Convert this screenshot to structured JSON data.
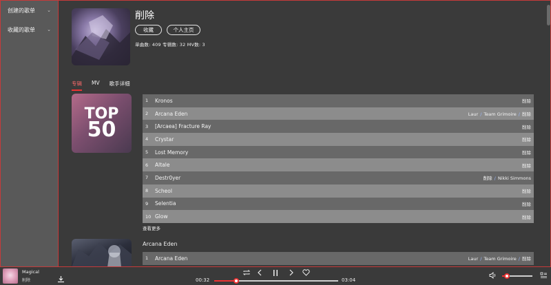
{
  "sidebar": {
    "items": [
      {
        "label": "创建的歌单"
      },
      {
        "label": "收藏的歌单"
      }
    ]
  },
  "artist": {
    "name": "削除",
    "collect_label": "收藏",
    "homepage_label": "个人主页",
    "stats": "单曲数: 409   专辑数: 32   MV数: 3"
  },
  "tabs": [
    {
      "label": "专辑",
      "active": true
    },
    {
      "label": "MV",
      "active": false
    },
    {
      "label": "歌手详细",
      "active": false
    }
  ],
  "album1": {
    "cover_text_1": "TOP",
    "cover_text_2": "50",
    "tracks": [
      {
        "num": "1",
        "title": "Kronos",
        "artists": [
          "削除"
        ]
      },
      {
        "num": "2",
        "title": "Arcana Eden",
        "artists": [
          "Laur",
          "Team Grimoire",
          "削除"
        ]
      },
      {
        "num": "3",
        "title": "[Arcaea] Fracture Ray",
        "artists": [
          "削除"
        ]
      },
      {
        "num": "4",
        "title": "Crystar",
        "artists": [
          "削除"
        ]
      },
      {
        "num": "5",
        "title": "Lost Memory",
        "artists": [
          "削除"
        ]
      },
      {
        "num": "6",
        "title": "Altale",
        "artists": [
          "削除"
        ]
      },
      {
        "num": "7",
        "title": "Destr0yer",
        "artists": [
          "削除",
          "Nikki Simmons"
        ]
      },
      {
        "num": "8",
        "title": "Scheol",
        "artists": [
          "削除"
        ]
      },
      {
        "num": "9",
        "title": "Selentia",
        "artists": [
          "削除"
        ]
      },
      {
        "num": "10",
        "title": "Glow",
        "artists": [
          "削除"
        ]
      }
    ],
    "more_label": "查看更多"
  },
  "album2": {
    "title": "Arcana Eden",
    "tracks": [
      {
        "num": "1",
        "title": "Arcana Eden",
        "artists": [
          "Laur",
          "Team Grimoire",
          "削除"
        ]
      }
    ]
  },
  "player": {
    "title": "Magical",
    "artist": "削除",
    "current_time": "00:32",
    "total_time": "03:04",
    "progress": 0.177,
    "volume": 0.15
  },
  "colors": {
    "accent": "#e33333",
    "background": "#3a3a3a",
    "sidebar": "#595959",
    "row_odd": "#686868",
    "row_even": "#8c8c8c",
    "separator": "#9bb8ff"
  },
  "icons": {
    "repeat": "repeat-icon",
    "prev": "previous-icon",
    "pause": "pause-icon",
    "next": "next-icon",
    "like": "heart-icon",
    "download": "download-icon",
    "volume": "volume-icon",
    "playlist": "playlist-icon"
  }
}
